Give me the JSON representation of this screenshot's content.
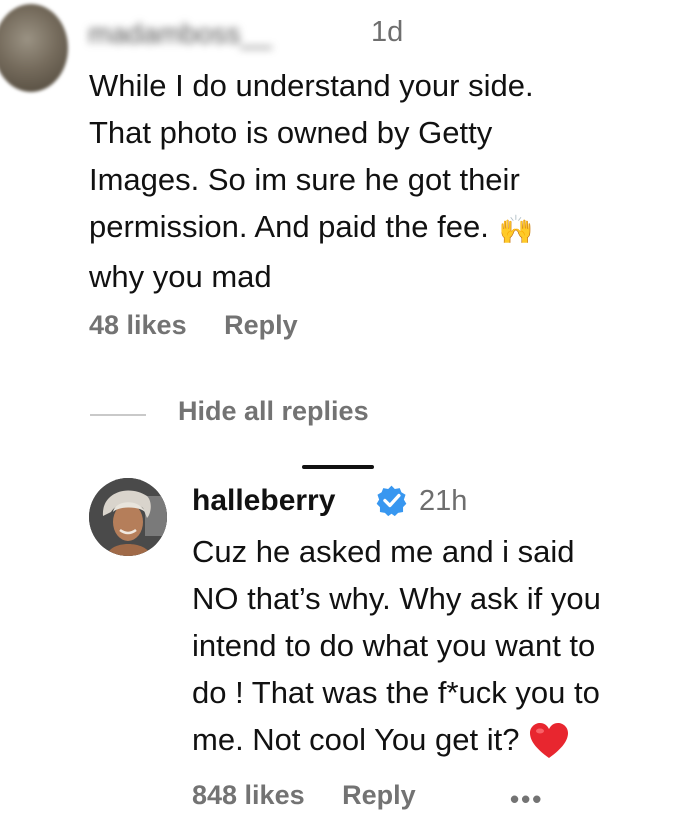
{
  "comment1": {
    "username": "madamboss__",
    "time": "1d",
    "lines": [
      "While I do understand your side.",
      "That photo is owned by Getty",
      "Images. So im sure he got their",
      "permission. And paid the fee.",
      "why you mad"
    ],
    "emoji": "🙌",
    "likes": "48 likes",
    "reply": "Reply"
  },
  "hide_replies": "Hide all replies",
  "comment2": {
    "username": "halleberry",
    "verified": true,
    "time": "21h",
    "lines": [
      "Cuz he asked me and i said",
      "NO that’s why. Why ask if you",
      "intend to do what you want to",
      "do ! That was the f*uck you to",
      "me. Not cool You get it?"
    ],
    "likes": "848 likes",
    "reply": "Reply",
    "more": "•••"
  },
  "colors": {
    "verified_blue": "#3897f0",
    "heart_red": "#e8262f",
    "meta_gray": "#737373"
  }
}
